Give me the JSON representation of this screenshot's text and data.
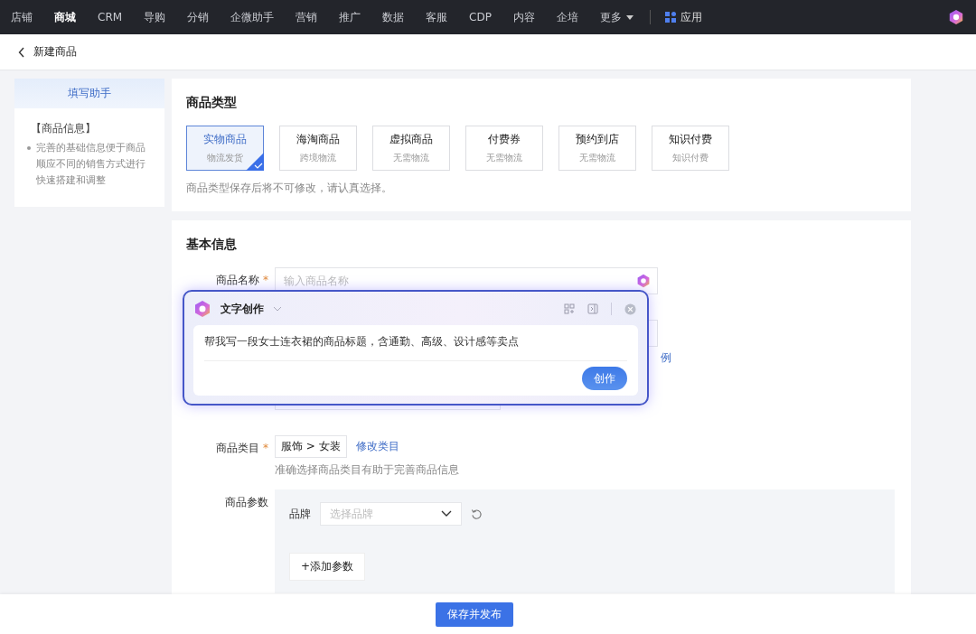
{
  "nav": {
    "items": [
      {
        "label": "店铺",
        "selected": false
      },
      {
        "label": "商城",
        "selected": true
      },
      {
        "label": "CRM",
        "selected": false
      },
      {
        "label": "导购",
        "selected": false
      },
      {
        "label": "分销",
        "selected": false
      },
      {
        "label": "企微助手",
        "selected": false
      },
      {
        "label": "营销",
        "selected": false
      },
      {
        "label": "推广",
        "selected": false
      },
      {
        "label": "数据",
        "selected": false
      },
      {
        "label": "客服",
        "selected": false
      },
      {
        "label": "CDP",
        "selected": false
      },
      {
        "label": "内容",
        "selected": false
      },
      {
        "label": "企培",
        "selected": false
      }
    ],
    "more": "更多",
    "apps": "应用"
  },
  "breadcrumb": {
    "title": "新建商品"
  },
  "helper": {
    "title": "填写助手",
    "heading": "【商品信息】",
    "bullets": [
      "完善的基础信息便于商品顺应不同的销售方式进行快速搭建和调整"
    ]
  },
  "product_type": {
    "title": "商品类型",
    "options": [
      {
        "name": "实物商品",
        "sub": "物流发货",
        "selected": true
      },
      {
        "name": "海淘商品",
        "sub": "跨境物流",
        "selected": false
      },
      {
        "name": "虚拟商品",
        "sub": "无需物流",
        "selected": false
      },
      {
        "name": "付费券",
        "sub": "无需物流",
        "selected": false
      },
      {
        "name": "预约到店",
        "sub": "无需物流",
        "selected": false
      },
      {
        "name": "知识付费",
        "sub": "知识付费",
        "selected": false
      }
    ],
    "note": "商品类型保存后将不可修改，请认真选择。"
  },
  "basic_info": {
    "title": "基本信息",
    "name_field": {
      "label": "商品名称",
      "required_mark": "*",
      "placeholder": "输入商品名称"
    },
    "hidden_link": "例",
    "category": {
      "label": "商品类目",
      "required_mark": "*",
      "value": "服饰 > 女装",
      "link": "修改类目",
      "hint": "准确选择商品类目有助于完善商品信息"
    },
    "params": {
      "label": "商品参数",
      "brand_label": "品牌",
      "brand_placeholder": "选择品牌",
      "add_button": "+添加参数"
    }
  },
  "ai_popup": {
    "title": "文字创作",
    "prompt": "帮我写一段女士连衣裙的商品标题，含通勤、高级、设计感等卖点",
    "submit": "创作"
  },
  "footer": {
    "button": "保存并发布"
  }
}
